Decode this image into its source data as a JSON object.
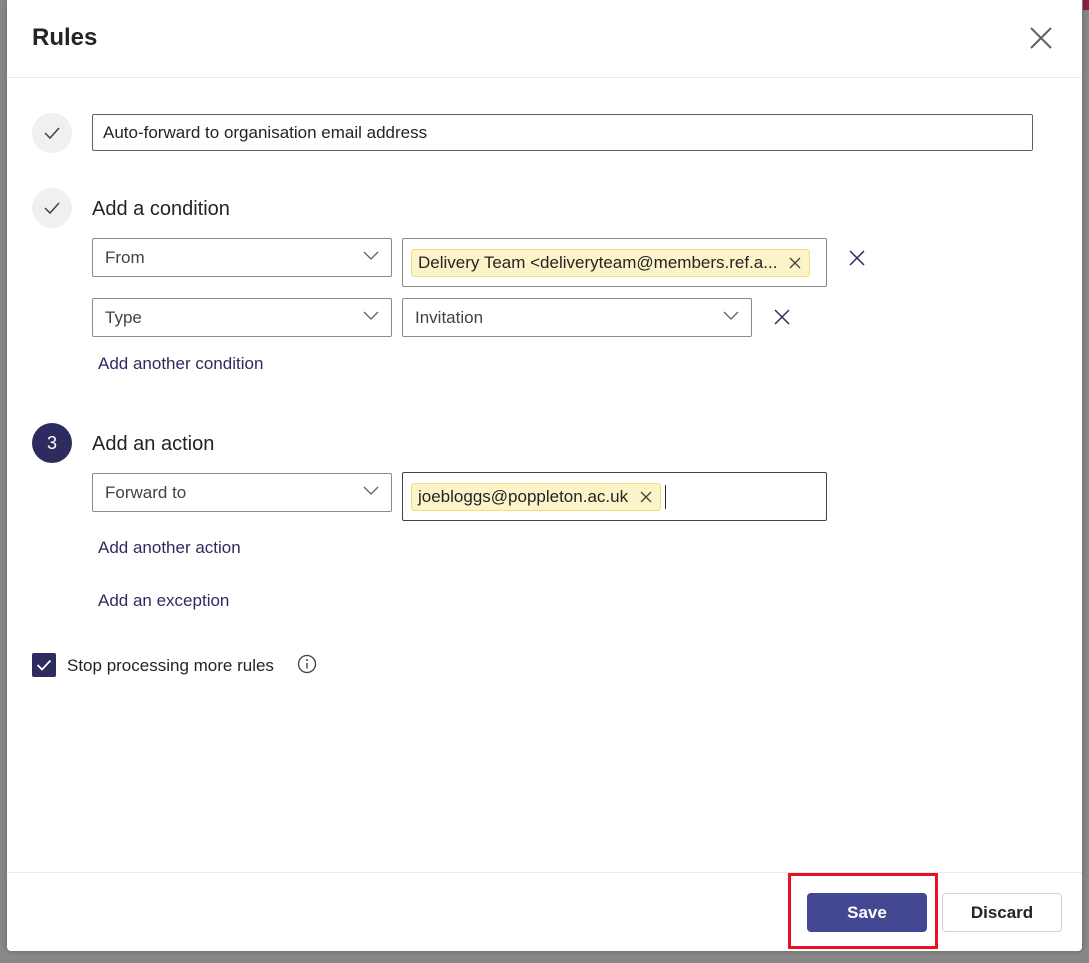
{
  "dialog": {
    "title": "Rules"
  },
  "rule_name": {
    "value": "Auto-forward to organisation email address"
  },
  "conditions": {
    "heading": "Add a condition",
    "rows": [
      {
        "field": "From",
        "value_pill": "Delivery Team <deliveryteam@members.ref.a..."
      },
      {
        "field": "Type",
        "value": "Invitation"
      }
    ],
    "add_link": "Add another condition"
  },
  "actions": {
    "step_number": "3",
    "heading": "Add an action",
    "rows": [
      {
        "field": "Forward to",
        "value_pill": "joebloggs@poppleton.ac.uk"
      }
    ],
    "add_link": "Add another action",
    "exception_link": "Add an exception"
  },
  "stop_processing": {
    "label": "Stop processing more rules",
    "checked": true
  },
  "footer": {
    "save_label": "Save",
    "discard_label": "Discard"
  },
  "colors": {
    "brand": "#444791",
    "step_active": "#2e2c5e",
    "pill_bg": "#fcf4c8",
    "highlight": "#e81123"
  },
  "icons": {
    "close": "close-icon",
    "check": "check-icon",
    "chevron": "chevron-down-icon",
    "remove": "remove-icon",
    "info": "info-icon"
  }
}
